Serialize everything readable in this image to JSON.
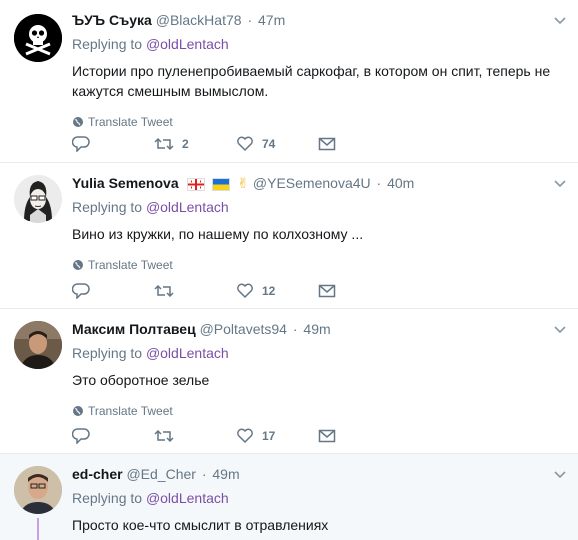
{
  "tweets": [
    {
      "fullname": "ЪУЪ Съука",
      "username": "@BlackHat78",
      "time": "47m",
      "replying_label": "Replying to",
      "replying_to": "@oldLentach",
      "text": "Истории про пуленепробиваемый саркофаг, в котором он спит, теперь не кажутся смешным вымыслом.",
      "translate": "Translate Tweet",
      "replies": "",
      "retweets": "2",
      "likes": "74"
    },
    {
      "fullname": "Yulia Semenova",
      "emoji": "✌",
      "username": "@YESemenova4U",
      "time": "40m",
      "replying_label": "Replying to",
      "replying_to": "@oldLentach",
      "text": "Вино из кружки, по нашему по колхозному ...",
      "translate": "Translate Tweet",
      "replies": "",
      "retweets": "",
      "likes": "12"
    },
    {
      "fullname": "Максим Полтавец",
      "username": "@Poltavets94",
      "time": "49m",
      "replying_label": "Replying to",
      "replying_to": "@oldLentach",
      "text": "Это оборотное зелье",
      "translate": "Translate Tweet",
      "replies": "",
      "retweets": "",
      "likes": "17"
    },
    {
      "fullname": "ed-cher",
      "username": "@Ed_Cher",
      "time": "49m",
      "replying_label": "Replying to",
      "replying_to": "@oldLentach",
      "text": "Просто кое-что смыслит в отравлениях"
    }
  ],
  "separator": "·",
  "icons": {
    "reply": "reply-icon",
    "retweet": "retweet-icon",
    "like": "heart-icon",
    "dm": "envelope-icon",
    "globe": "globe-icon",
    "caret": "chevron-down-icon"
  },
  "colors": {
    "link": "#7b4fa6",
    "secondary_text": "#657786",
    "thread_line": "#c9a0e8",
    "highlight_bg": "#f5f8fa"
  }
}
